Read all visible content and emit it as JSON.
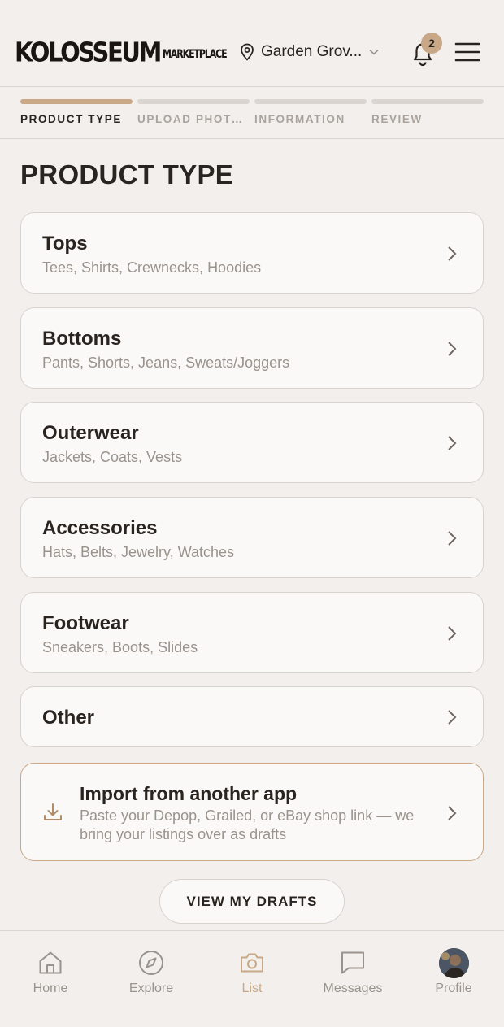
{
  "header": {
    "logo_main": "KOLOSSEUM",
    "logo_sub": "MARKETPLACE",
    "location": "Garden Grov...",
    "notification_count": "2",
    "icons": [
      "location-pin-icon",
      "chevron-down-icon",
      "bell-icon",
      "menu-icon"
    ]
  },
  "steps": [
    {
      "label": "PRODUCT TYPE",
      "active": true
    },
    {
      "label": "UPLOAD PHOTOS",
      "active": false
    },
    {
      "label": "INFORMATION",
      "active": false
    },
    {
      "label": "REVIEW",
      "active": false
    }
  ],
  "page_title": "PRODUCT TYPE",
  "categories": [
    {
      "title": "Tops",
      "subtitle": "Tees, Shirts, Crewnecks, Hoodies"
    },
    {
      "title": "Bottoms",
      "subtitle": "Pants, Shorts, Jeans, Sweats/Joggers"
    },
    {
      "title": "Outerwear",
      "subtitle": "Jackets, Coats, Vests"
    },
    {
      "title": "Accessories",
      "subtitle": "Hats, Belts, Jewelry, Watches"
    },
    {
      "title": "Footwear",
      "subtitle": "Sneakers, Boots, Slides"
    },
    {
      "title": "Other",
      "subtitle": ""
    }
  ],
  "import": {
    "title": "Import from another app",
    "description": "Paste your Depop, Grailed, or eBay shop link — we bring your listings over as drafts"
  },
  "drafts_button": "VIEW MY DRAFTS",
  "tabs": [
    {
      "label": "Home",
      "icon": "home-icon",
      "active": false
    },
    {
      "label": "Explore",
      "icon": "compass-icon",
      "active": false
    },
    {
      "label": "List",
      "icon": "camera-icon",
      "active": true
    },
    {
      "label": "Messages",
      "icon": "message-icon",
      "active": false
    },
    {
      "label": "Profile",
      "icon": "avatar",
      "active": false
    }
  ],
  "colors": {
    "background": "#f3efec",
    "card": "#fbf9f7",
    "accent": "#c8a887",
    "text": "#2a2420",
    "muted": "#9a938d"
  }
}
